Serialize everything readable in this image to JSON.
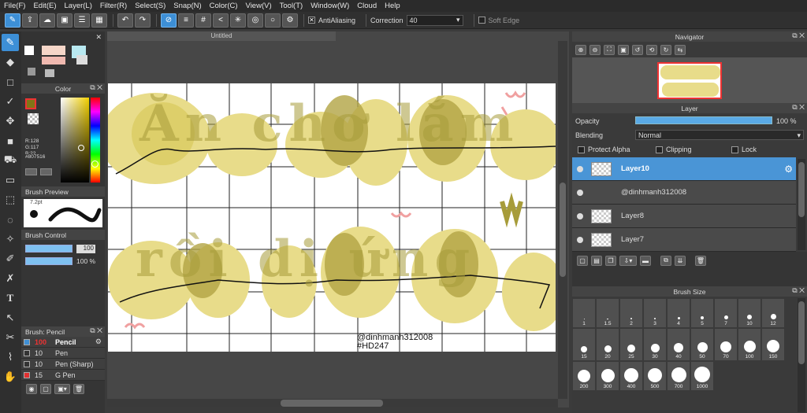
{
  "menu": [
    "File(F)",
    "Edit(E)",
    "Layer(L)",
    "Filter(R)",
    "Select(S)",
    "Snap(N)",
    "Color(C)",
    "View(V)",
    "Tool(T)",
    "Window(W)",
    "Cloud",
    "Help"
  ],
  "toolbar": {
    "antialiasing_label": "AntiAliasing",
    "correction_label": "Correction",
    "correction_value": "40",
    "soft_edge_label": "Soft Edge"
  },
  "canvas": {
    "tab_title": "Untitled",
    "watermark_line1": "@dinhmanh312008",
    "watermark_line2": "#HD247",
    "lettering_line1": "Ăn chơ lắm",
    "lettering_line2": "rồi dị ứng"
  },
  "color_panel": {
    "title": "Color",
    "r": "R:128",
    "g": "G:117",
    "b": "B:22",
    "hex": "#807516",
    "main_color": "#807516"
  },
  "brush_preview": {
    "title": "Brush Preview",
    "size_label": "7.2pt"
  },
  "brush_control": {
    "title": "Brush Control",
    "size": "100",
    "opacity": "100 %"
  },
  "brush_list": {
    "title": "Brush: Pencil",
    "items": [
      {
        "size": "100",
        "name": "Pencil",
        "color": "#3f8fd5"
      },
      {
        "size": "10",
        "name": "Pen",
        "color": "#333333"
      },
      {
        "size": "10",
        "name": "Pen (Sharp)",
        "color": "#333333"
      },
      {
        "size": "15",
        "name": "G Pen",
        "color": "#e03030"
      }
    ]
  },
  "navigator": {
    "title": "Navigator"
  },
  "layer_panel": {
    "title": "Layer",
    "opacity_label": "Opacity",
    "opacity_value": "100 %",
    "opacity_fill": 1.0,
    "blending_label": "Blending",
    "blending_value": "Normal",
    "protect_alpha": "Protect Alpha",
    "clipping": "Clipping",
    "lock": "Lock",
    "layers": [
      "Layer10",
      "@dinhmanh312008",
      "Layer8",
      "Layer7"
    ]
  },
  "brush_size_panel": {
    "title": "Brush Size",
    "sizes": [
      "1",
      "1.5",
      "2",
      "3",
      "4",
      "5",
      "7",
      "10",
      "12",
      "15",
      "20",
      "25",
      "30",
      "40",
      "50",
      "70",
      "100",
      "150",
      "200",
      "300",
      "400",
      "500",
      "700",
      "1000"
    ]
  },
  "colors": {
    "accent": "#3d8fd6",
    "yellow": "#e8dc8a",
    "olive": "#a79c3a"
  }
}
